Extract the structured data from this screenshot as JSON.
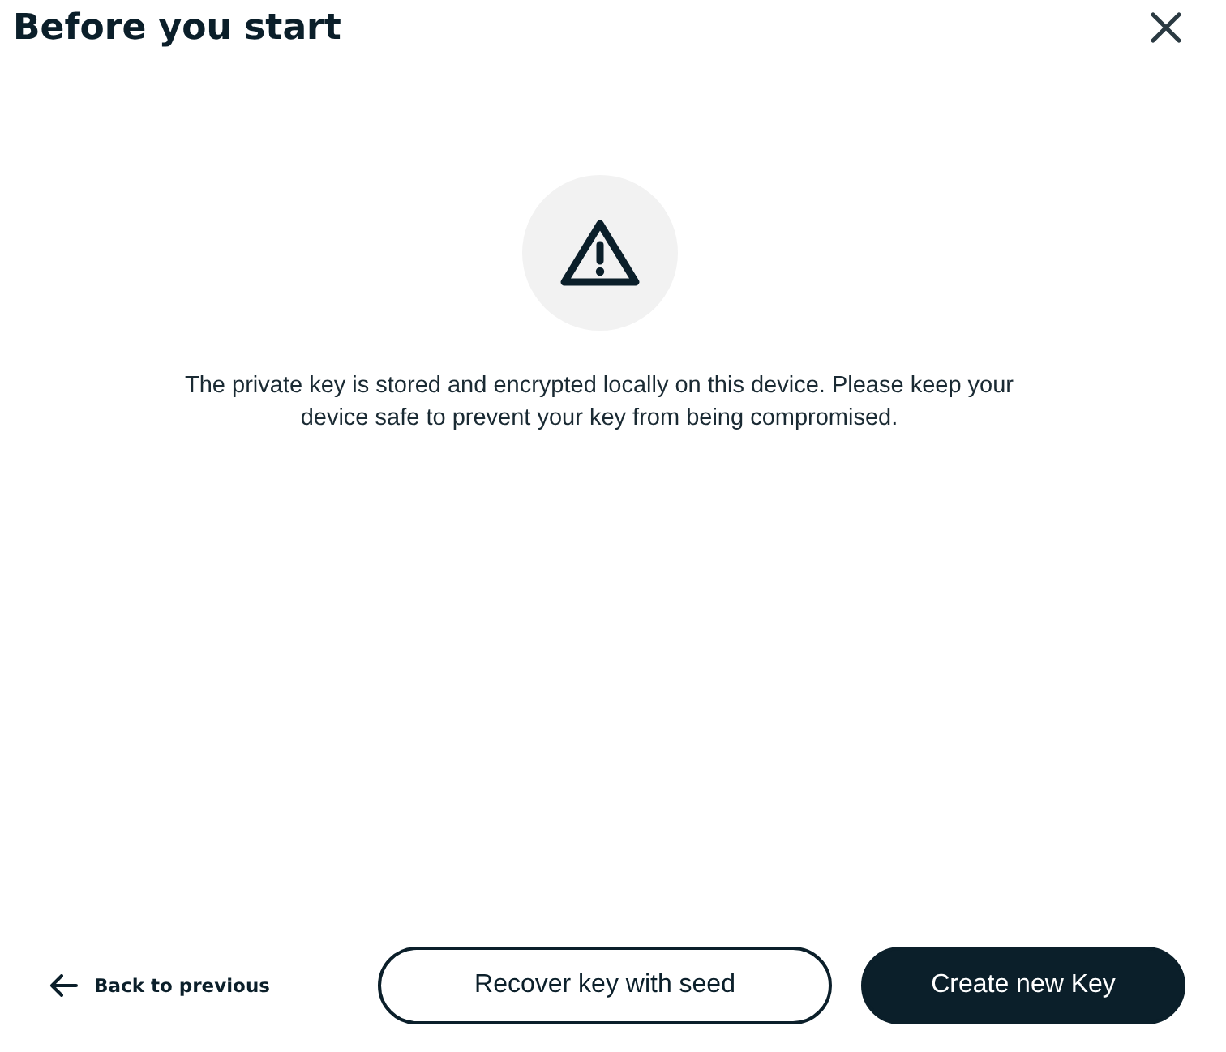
{
  "dialog": {
    "title": "Before you start"
  },
  "message": "The private key is stored and encrypted locally on this device. Please keep your device safe to prevent your key from being compromised.",
  "footer": {
    "back_link": "Back to previous",
    "buttons": [
      {
        "label": "Recover key with seed",
        "kind": "secondary"
      },
      {
        "label": "Create new Key",
        "kind": "primary"
      }
    ]
  }
}
